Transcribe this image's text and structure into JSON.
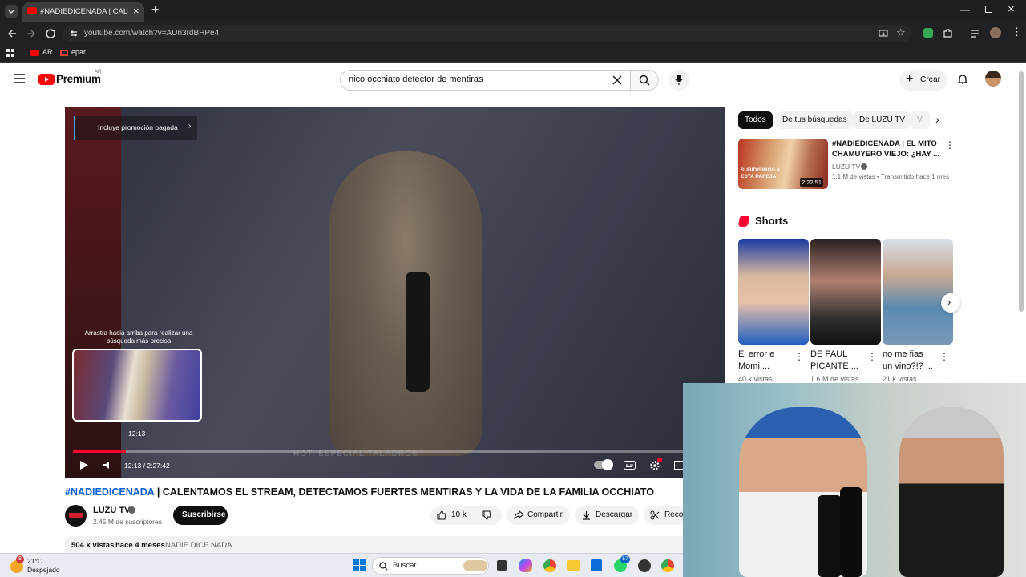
{
  "browser": {
    "tab_title": "#NADIEDICENADA | CALENTAM",
    "url": "youtube.com/watch?v=AUn3rdBHPe4",
    "bookmarks": [
      {
        "label": "AR"
      },
      {
        "label": "epar"
      }
    ]
  },
  "youtube": {
    "logo_text": "Premium",
    "logo_region": "AR",
    "search": {
      "value": "nico occhiato detector de mentiras"
    },
    "create_label": "Crear",
    "colors": {
      "brand_red": "#ff0000",
      "progress_red": "#ff0033"
    }
  },
  "player": {
    "promo_label": "Incluye promoción pagada",
    "drag_hint_line1": "Arrastra hacia arriba para realizar una",
    "drag_hint_line2": "búsqueda más precisa",
    "preview_time": "12:13",
    "time_display": "12:13 / 2:27:42",
    "progress": 0.082,
    "overlay_bottom_text": "HOT: ESPECIAL TALADROS"
  },
  "video": {
    "hashtag": "#NADIEDICENADA",
    "title_rest": " | CALENTAMOS EL STREAM, DETECTAMOS FUERTES MENTIRAS Y LA VIDA DE LA FAMILIA OCCHIATO",
    "channel": "LUZU TV",
    "subscribers": "2.45 M de suscriptores",
    "subscribe_label": "Suscribirse",
    "likes": "10 k",
    "share_label": "Compartir",
    "download_label": "Descargar",
    "clip_label": "Reco",
    "views": "504 k vistas",
    "age": "hace 4 meses",
    "tag": "NADIE DICE NADA"
  },
  "sidebar": {
    "chips": [
      "Todos",
      "De tus búsquedas",
      "De LUZU TV",
      "Vi"
    ],
    "rec": {
      "title_line1": "#NADIEDICENADA | EL MITO",
      "title_line2": "CHAMUYERO VIEJO: ¿HAY ...",
      "channel": "LUZU TV",
      "meta": "1.1 M de vistas • Transmitido hace 1 mes",
      "duration": "2:22:51",
      "thumb_text1": "SUBIDÍSIMOS A",
      "thumb_text2": "ESTA PAREJA"
    },
    "shorts_label": "Shorts",
    "shorts": [
      {
        "line1": "El error e",
        "line2": "Momi ...",
        "views": "40 k vistas"
      },
      {
        "line1": "DE PAUL",
        "line2": "PICANTE ...",
        "views": "1.6 M de vistas"
      },
      {
        "line1": "no me fias",
        "line2": "un vino?!? ...",
        "views": "21 k vistas"
      }
    ]
  },
  "taskbar": {
    "weather_temp": "21°C",
    "weather_desc": "Despejado",
    "weather_badge": "8",
    "search_placeholder": "Buscar",
    "badge_57": "57"
  }
}
